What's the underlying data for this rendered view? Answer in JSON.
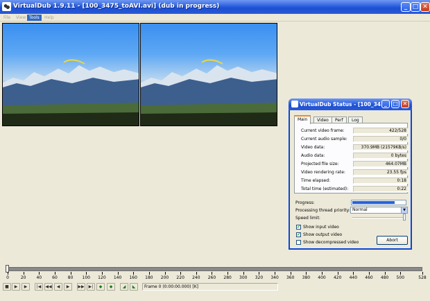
{
  "window": {
    "title": "VirtualDub 1.9.11 - [100_3475_toAVI.avi] (dub in progress)",
    "minimize_glyph": "_",
    "maximize_glyph": "□",
    "close_glyph": "✕"
  },
  "menu": [
    "File",
    "View",
    "Tools",
    "Help"
  ],
  "panes": [
    {
      "name": "input-video-pane"
    },
    {
      "name": "output-video-pane"
    }
  ],
  "status": {
    "title": "VirtualDub Status - [100_34...",
    "tabs": [
      "Main",
      "Video",
      "Perf",
      "Log"
    ],
    "active_tab": "Main",
    "stats": [
      {
        "label": "Current video frame:",
        "value": "422/528"
      },
      {
        "label": "Current audio sample:",
        "value": "0/0"
      },
      {
        "label": "Video data:",
        "value": "370.9MB (21579KB/s)"
      },
      {
        "label": "Audio data:",
        "value": "0 bytes"
      },
      {
        "label": "Projected file size:",
        "value": "464.07MB"
      },
      {
        "label": "Video rendering rate:",
        "value": "23.55 fps"
      },
      {
        "label": "Time elapsed:",
        "value": "0:18"
      },
      {
        "label": "Total time (estimated):",
        "value": "0:22"
      }
    ],
    "progress_label": "Progress:",
    "progress_fraction": 0.8,
    "priority_label": "Processing thread priority:",
    "priority_value": "Normal",
    "speed_label": "Speed limit:",
    "speed_level": 1.0,
    "checkboxes": [
      {
        "label": "Show input video",
        "checked": true
      },
      {
        "label": "Show output video",
        "checked": true
      },
      {
        "label": "Show decompressed video",
        "checked": false
      }
    ],
    "abort_label": "Abort"
  },
  "timeline": {
    "max_frame": 528,
    "current_frame": 0,
    "tick_labels": [
      "0",
      "20",
      "40",
      "60",
      "80",
      "100",
      "120",
      "140",
      "160",
      "180",
      "200",
      "220",
      "240",
      "260",
      "280",
      "300",
      "320",
      "340",
      "360",
      "380",
      "400",
      "420",
      "440",
      "460",
      "480",
      "500",
      "528"
    ]
  },
  "toolbar": {
    "buttons": [
      "stop",
      "play-input",
      "play-output",
      "start",
      "prev-key",
      "prev",
      "next",
      "next-key",
      "end",
      "scene-prev",
      "scene-next",
      "mark-in",
      "mark-out",
      "prev-edit",
      "next-edit"
    ],
    "frame_readout": "Frame 0 (0:00:00.000) [K]"
  },
  "colors": {
    "title_blue": "#2c5fdf",
    "progress_blue": "#2860d8",
    "face": "#ece9d8"
  }
}
